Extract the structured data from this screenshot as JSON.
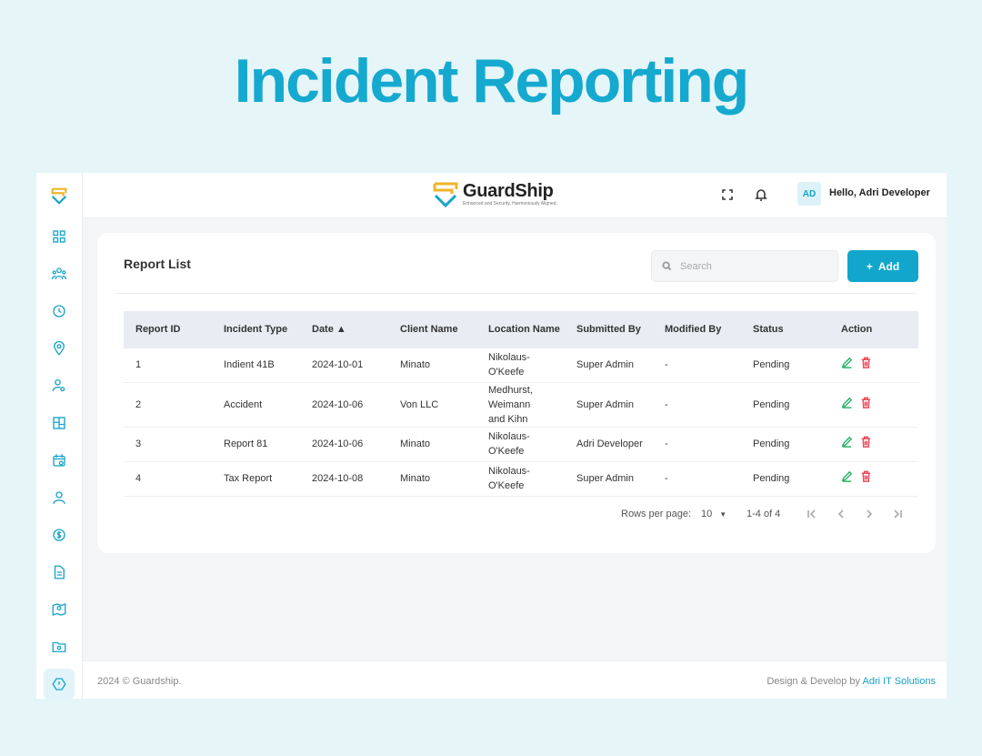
{
  "hero": {
    "title": "Incident Reporting"
  },
  "brand": {
    "name": "GuardShip",
    "tagline": "Enhanced and Security, Harmoniously Aligned."
  },
  "header": {
    "avatar_initials": "AD",
    "greeting": "Hello, Adri Developer"
  },
  "report_list": {
    "title": "Report List",
    "search_placeholder": "Search",
    "add_label": "Add",
    "columns": [
      "Report ID",
      "Incident Type",
      "Date ▲",
      "Client Name",
      "Location Name",
      "Submitted By",
      "Modified By",
      "Status",
      "Action"
    ],
    "rows": [
      {
        "id": "1",
        "incident_type": "Indient 41B",
        "date": "2024-10-01",
        "client": "Minato",
        "location": "Nikolaus-O'Keefe",
        "submitted_by": "Super Admin",
        "modified_by": "-",
        "status": "Pending"
      },
      {
        "id": "2",
        "incident_type": "Accident",
        "date": "2024-10-06",
        "client": "Von LLC",
        "location": "Medhurst, Weimann and Kihn",
        "submitted_by": "Super Admin",
        "modified_by": "-",
        "status": "Pending"
      },
      {
        "id": "3",
        "incident_type": "Report 81",
        "date": "2024-10-06",
        "client": "Minato",
        "location": "Nikolaus-O'Keefe",
        "submitted_by": "Adri Developer",
        "modified_by": "-",
        "status": "Pending"
      },
      {
        "id": "4",
        "incident_type": "Tax Report",
        "date": "2024-10-08",
        "client": "Minato",
        "location": "Nikolaus-O'Keefe",
        "submitted_by": "Super Admin",
        "modified_by": "-",
        "status": "Pending"
      }
    ]
  },
  "pagination": {
    "rows_per_page_label": "Rows per page:",
    "rows_per_page_value": "10",
    "range": "1-4 of 4"
  },
  "footer": {
    "copyright": "2024 © Guardship.",
    "credit_prefix": "Design & Develop by ",
    "credit_link": "Adri IT Solutions"
  },
  "colors": {
    "accent": "#15a9cf",
    "edit": "#2fb36b",
    "delete": "#ea4b5a",
    "logo_gold": "#f0b429"
  },
  "icons": [
    "dashboard-icon",
    "users-group-icon",
    "clock-icon",
    "location-pin-icon",
    "user-settings-icon",
    "layout-icon",
    "calendar-icon",
    "user-icon",
    "dollar-icon",
    "document-icon",
    "map-user-icon",
    "folder-settings-icon",
    "incident-icon"
  ]
}
